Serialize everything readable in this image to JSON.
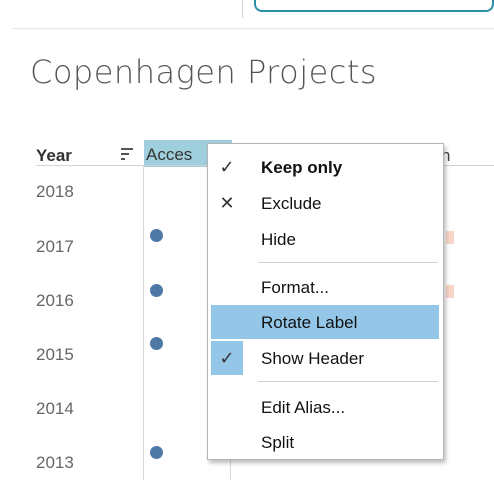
{
  "sheet": {
    "title": "Copenhagen Projects"
  },
  "table": {
    "headers": {
      "year": "Year",
      "access": "Acces",
      "partial": "n"
    },
    "rows": [
      {
        "year": "2018",
        "has_dot": false,
        "has_bar": false
      },
      {
        "year": "2017",
        "has_dot": true,
        "has_bar": true
      },
      {
        "year": "2016",
        "has_dot": true,
        "has_bar": true
      },
      {
        "year": "2015",
        "has_dot": true,
        "has_bar": false
      },
      {
        "year": "2014",
        "has_dot": false,
        "has_bar": false
      },
      {
        "year": "2013",
        "has_dot": true,
        "has_bar": false
      }
    ]
  },
  "context_menu": {
    "items": [
      {
        "label": "Keep only",
        "mark": "✓",
        "icon": "checkmark-icon",
        "bold": true
      },
      {
        "label": "Exclude",
        "mark": "✕",
        "icon": "x-icon"
      },
      {
        "label": "Hide"
      },
      {
        "label": "Format..."
      },
      {
        "label": "Rotate Label",
        "highlighted": true
      },
      {
        "label": "Show Header",
        "mark": "✓",
        "icon": "checkmark-icon",
        "checked": true
      },
      {
        "label": "Edit Alias..."
      },
      {
        "label": "Split"
      }
    ]
  },
  "colors": {
    "selected_header": "#9fcfdc",
    "menu_highlight": "#94c6e8",
    "mark": "#4e79a7",
    "accent": "#2b8fa6"
  }
}
